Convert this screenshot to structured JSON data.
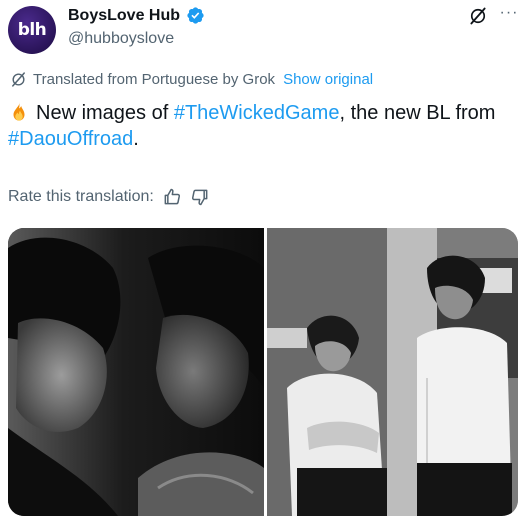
{
  "author": {
    "display_name": "BoysLove Hub",
    "handle": "@hubboyslove",
    "avatar_text": "blh"
  },
  "translation": {
    "notice": "Translated from Portuguese by Grok",
    "show_original": "Show original"
  },
  "tweet": {
    "emoji": "fire-emoji",
    "text_1": "New images of ",
    "hashtag_1": "#TheWickedGame",
    "text_2": ", the new BL from ",
    "hashtag_2": "#DaouOffroad",
    "text_3": "."
  },
  "rating": {
    "label": "Rate this translation:"
  },
  "colors": {
    "link": "#1d9bf0",
    "secondary_text": "#536471",
    "verified": "#1d9bf0",
    "avatar_bg": "#2a1459"
  },
  "icons": [
    "verified-badge-icon",
    "grok-icon",
    "more-icon",
    "thumbs-up-icon",
    "thumbs-down-icon"
  ],
  "media": {
    "photos": [
      "black-and-white photo of two young men face to face",
      "black-and-white photo of two men in white shirts standing facing each other"
    ]
  }
}
